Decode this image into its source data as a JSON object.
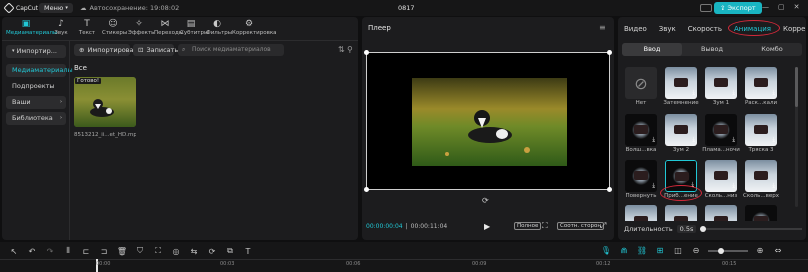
{
  "topbar": {
    "app_name": "CapCut",
    "menu_label": "Меню",
    "autosave": "Автосохранение: 19:08:02",
    "project_title": "0817",
    "pro_label": "Pro",
    "export_label": "Экспорт"
  },
  "toolbar": {
    "items": [
      {
        "label": "Медиаматериалы",
        "icon": "media-icon"
      },
      {
        "label": "Звук",
        "icon": "music-icon"
      },
      {
        "label": "Текст",
        "icon": "text-icon"
      },
      {
        "label": "Стикеры",
        "icon": "sticker-icon"
      },
      {
        "label": "Эффекты",
        "icon": "effects-icon"
      },
      {
        "label": "Переходы",
        "icon": "transition-icon"
      },
      {
        "label": "Субтитры",
        "icon": "subtitles-icon"
      },
      {
        "label": "Фильтры",
        "icon": "filter-icon"
      },
      {
        "label": "Корректировка",
        "icon": "adjust-icon"
      }
    ]
  },
  "sidebar": {
    "items": [
      "Импортир...",
      "Медиаматериалы",
      "Подпроекты",
      "Ваши",
      "Библиотека"
    ]
  },
  "media": {
    "import_label": "Импортировать",
    "record_label": "Записать",
    "search_placeholder": "Поиск медиаматериалов",
    "section_all": "Все",
    "clip_badge": "Готово!",
    "clip_name": "8513212_ii...et_HD.mp4"
  },
  "player": {
    "title": "Плеер",
    "time_current": "00:00:00:04",
    "time_total": "00:00:11:04",
    "full_label": "Полное",
    "ratio_label": "Соотн. сторон"
  },
  "right": {
    "tabs": [
      "Видео",
      "Звук",
      "Скорость",
      "Анимация",
      "Корре"
    ],
    "subtabs": [
      "Ввод",
      "Вывод",
      "Комбо"
    ],
    "animations": [
      "Нет",
      "Затемнение",
      "Зум 1",
      "Раск...кали",
      "Волш...вка",
      "Зум 2",
      "Плама...ночи",
      "Тряска 3",
      "Повернуть",
      "Приб...ение",
      "Сколь...низ",
      "Сколь...верх",
      "",
      "",
      "",
      ""
    ],
    "duration_label": "Длительность",
    "duration_value": "0.5s"
  },
  "timeline": {
    "ruler": [
      "00:00",
      "00:03",
      "00:06",
      "00:09",
      "00:12",
      "00:15"
    ]
  },
  "colors": {
    "accent": "#21c8d6",
    "highlight_circle": "#d3293a"
  }
}
